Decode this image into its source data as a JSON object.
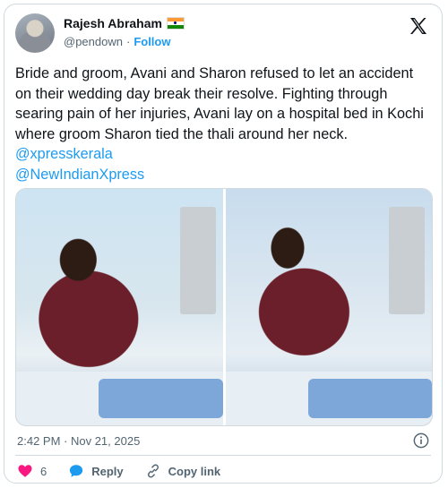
{
  "author": {
    "name": "Rajesh Abraham",
    "handle": "@pendown",
    "separator": "·",
    "follow_label": "Follow"
  },
  "tweet": {
    "text": "Bride and groom, Avani and Sharon refused to let an accident on their wedding day break their resolve. Fighting through searing pain of her injuries, Avani lay on a hospital bed in Kochi where groom Sharon tied the thali around her neck.",
    "mention_1": "@xpresskerala",
    "mention_2": "@NewIndianXpress"
  },
  "timestamp": "2:42 PM · Nov 21, 2025",
  "actions": {
    "like_count": "6",
    "reply_label": "Reply",
    "copy_link_label": "Copy link"
  },
  "colors": {
    "accent": "#1d9bf0",
    "like": "#f91880",
    "text": "#0f1419",
    "muted": "#536471"
  },
  "icons": [
    "x-logo-icon",
    "info-icon",
    "heart-icon",
    "reply-bubble-icon",
    "link-icon",
    "india-flag-icon"
  ]
}
